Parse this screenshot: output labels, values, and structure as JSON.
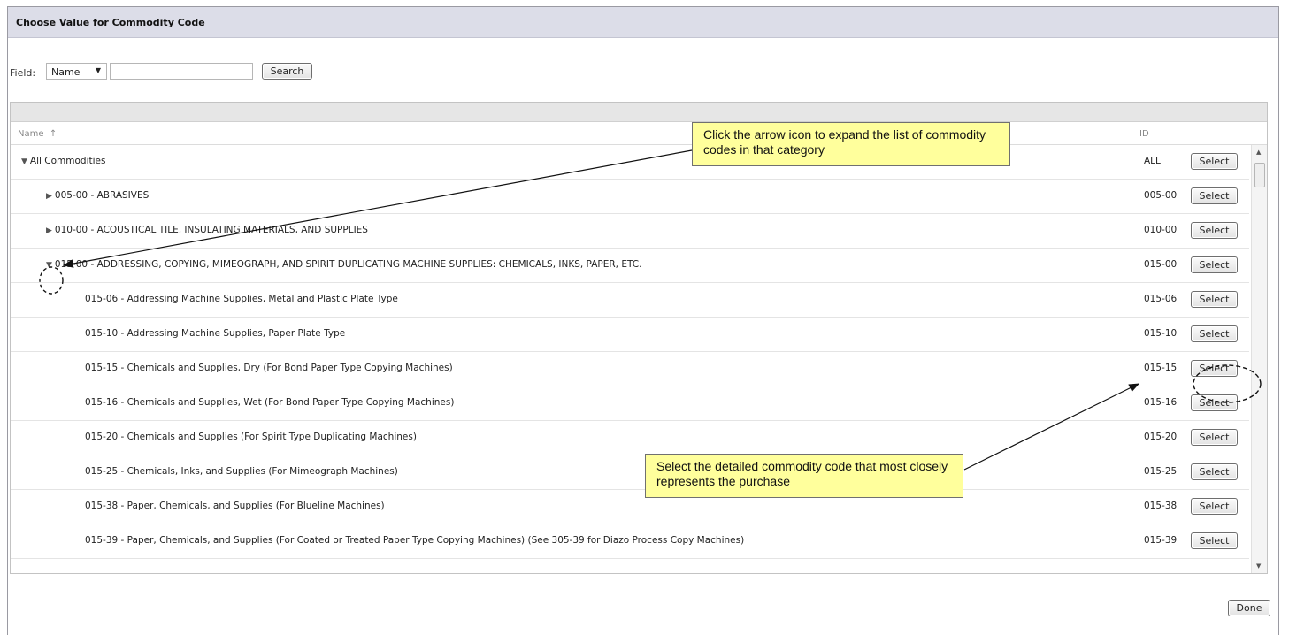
{
  "dialog": {
    "title": "Choose Value for Commodity Code"
  },
  "search": {
    "field_label": "Field:",
    "field_select_value": "Name",
    "query_value": "",
    "search_button": "Search"
  },
  "grid": {
    "columns": {
      "name": "Name",
      "sort_indicator": "↑",
      "id": "ID"
    },
    "rows": [
      {
        "name": "All Commodities",
        "id": "ALL",
        "level": 0,
        "toggle": "expanded",
        "select": "Select"
      },
      {
        "name": "005-00 - ABRASIVES",
        "id": "005-00",
        "level": 1,
        "toggle": "collapsed",
        "select": "Select"
      },
      {
        "name": "010-00 - ACOUSTICAL TILE, INSULATING MATERIALS, AND SUPPLIES",
        "id": "010-00",
        "level": 1,
        "toggle": "collapsed",
        "select": "Select"
      },
      {
        "name": "015-00 - ADDRESSING, COPYING, MIMEOGRAPH, AND SPIRIT DUPLICATING MACHINE SUPPLIES: CHEMICALS, INKS, PAPER, ETC.",
        "id": "015-00",
        "level": 1,
        "toggle": "expanded",
        "select": "Select"
      },
      {
        "name": "015-06 - Addressing Machine Supplies, Metal and Plastic Plate Type",
        "id": "015-06",
        "level": 2,
        "toggle": "none",
        "select": "Select"
      },
      {
        "name": "015-10 - Addressing Machine Supplies, Paper Plate Type",
        "id": "015-10",
        "level": 2,
        "toggle": "none",
        "select": "Select"
      },
      {
        "name": "015-15 - Chemicals and Supplies, Dry (For Bond Paper Type Copying Machines)",
        "id": "015-15",
        "level": 2,
        "toggle": "none",
        "select": "Select"
      },
      {
        "name": "015-16 - Chemicals and Supplies, Wet (For Bond Paper Type Copying Machines)",
        "id": "015-16",
        "level": 2,
        "toggle": "none",
        "select": "Select"
      },
      {
        "name": "015-20 - Chemicals and Supplies (For Spirit Type Duplicating Machines)",
        "id": "015-20",
        "level": 2,
        "toggle": "none",
        "select": "Select"
      },
      {
        "name": "015-25 - Chemicals, Inks, and Supplies (For Mimeograph Machines)",
        "id": "015-25",
        "level": 2,
        "toggle": "none",
        "select": "Select"
      },
      {
        "name": "015-38 - Paper, Chemicals, and Supplies (For Blueline Machines)",
        "id": "015-38",
        "level": 2,
        "toggle": "none",
        "select": "Select"
      },
      {
        "name": "015-39 - Paper, Chemicals, and Supplies (For Coated or Treated Paper Type Copying Machines) (See 305-39 for Diazo Process Copy Machines)",
        "id": "015-39",
        "level": 2,
        "toggle": "none",
        "select": "Select"
      }
    ]
  },
  "footer": {
    "done_button": "Done"
  },
  "annotations": {
    "expand_note": "Click the arrow icon to expand the list of commodity codes in that category",
    "select_note": "Select the detailed commodity code that most closely represents the purchase"
  },
  "colors": {
    "title_bar": "#dcdde8",
    "callout": "#ffff9c"
  }
}
